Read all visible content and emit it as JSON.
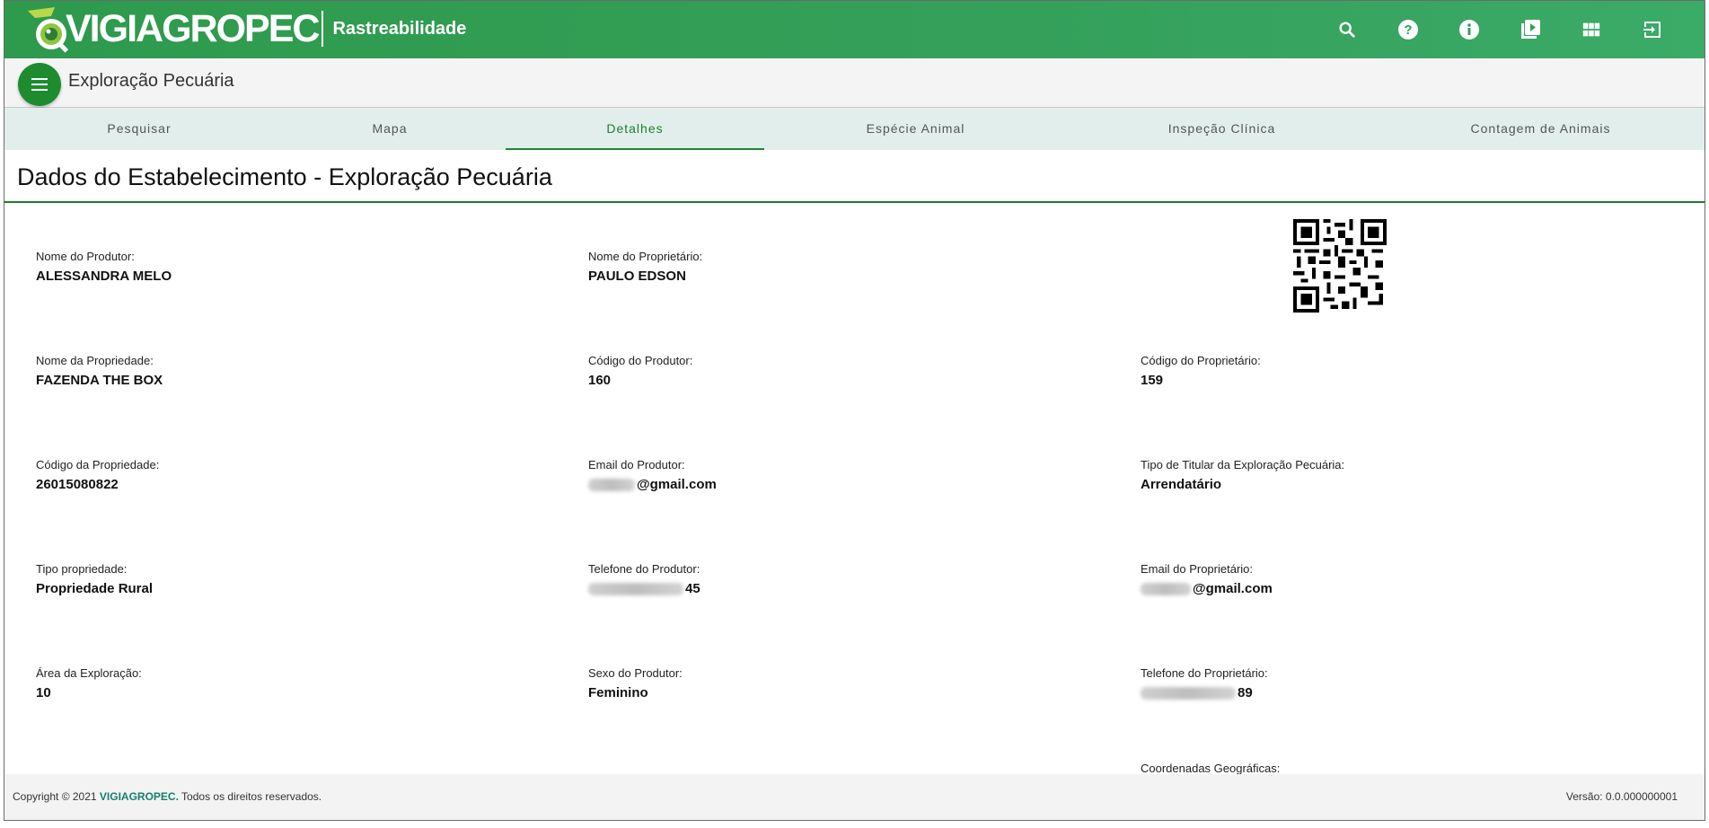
{
  "header": {
    "logo_text": "VIGIAGROPEC",
    "logo_subtitle": "Rastreabilidade",
    "icons": [
      "search-icon",
      "help-icon",
      "info-icon",
      "video-library-icon",
      "apps-grid-icon",
      "logout-icon"
    ]
  },
  "titlebar": {
    "page_title": "Exploração Pecuária"
  },
  "tabs": [
    {
      "label": "Pesquisar"
    },
    {
      "label": "Mapa"
    },
    {
      "label": "Detalhes"
    },
    {
      "label": "Espécie Animal"
    },
    {
      "label": "Inspeção Clínica"
    },
    {
      "label": "Contagem de Animais"
    }
  ],
  "active_tab": "Detalhes",
  "section": {
    "title": "Dados do Estabelecimento - Exploração Pecuária"
  },
  "fields": {
    "nome_produtor": {
      "label": "Nome do Produtor:",
      "value": "ALESSANDRA MELO"
    },
    "nome_proprietario": {
      "label": "Nome do Proprietário:",
      "value": "PAULO EDSON"
    },
    "nome_propriedade": {
      "label": "Nome da Propriedade:",
      "value": "FAZENDA THE BOX"
    },
    "codigo_produtor": {
      "label": "Código do Produtor:",
      "value": "160"
    },
    "codigo_proprietario": {
      "label": "Código do Proprietário:",
      "value": "159"
    },
    "codigo_propriedade": {
      "label": "Código da Propriedade:",
      "value": "26015080822"
    },
    "email_produtor": {
      "label": "Email do Produtor:",
      "value": "@gmail.com"
    },
    "tipo_titular": {
      "label": "Tipo de Titular da Exploração Pecuária:",
      "value": "Arrendatário"
    },
    "tipo_propriedade": {
      "label": "Tipo propriedade:",
      "value": "Propriedade Rural"
    },
    "telefone_produtor": {
      "label": "Telefone do Produtor:",
      "value": "45"
    },
    "email_proprietario": {
      "label": "Email do Proprietário:",
      "value": "@gmail.com"
    },
    "area_exploracao": {
      "label": "Área da Exploração:",
      "value": "10"
    },
    "sexo_produtor": {
      "label": "Sexo do Produtor:",
      "value": "Feminino"
    },
    "telefone_proprietario": {
      "label": "Telefone do Proprietário:",
      "value": "89"
    },
    "coordenadas": {
      "label": "Coordenadas Geográficas:"
    }
  },
  "footer": {
    "copyright": "Copyright © 2021",
    "brand": "VIGIAGROPEC.",
    "rights": "Todos os direitos reservados.",
    "version": "Versão: 0.0.000000001"
  },
  "colors": {
    "header_green": "#34a05a",
    "menu_button": "#1e8b2f",
    "tab_bar": "#e1eeec",
    "active_tab": "#1c7f2e",
    "footer_brand": "#15806f"
  }
}
